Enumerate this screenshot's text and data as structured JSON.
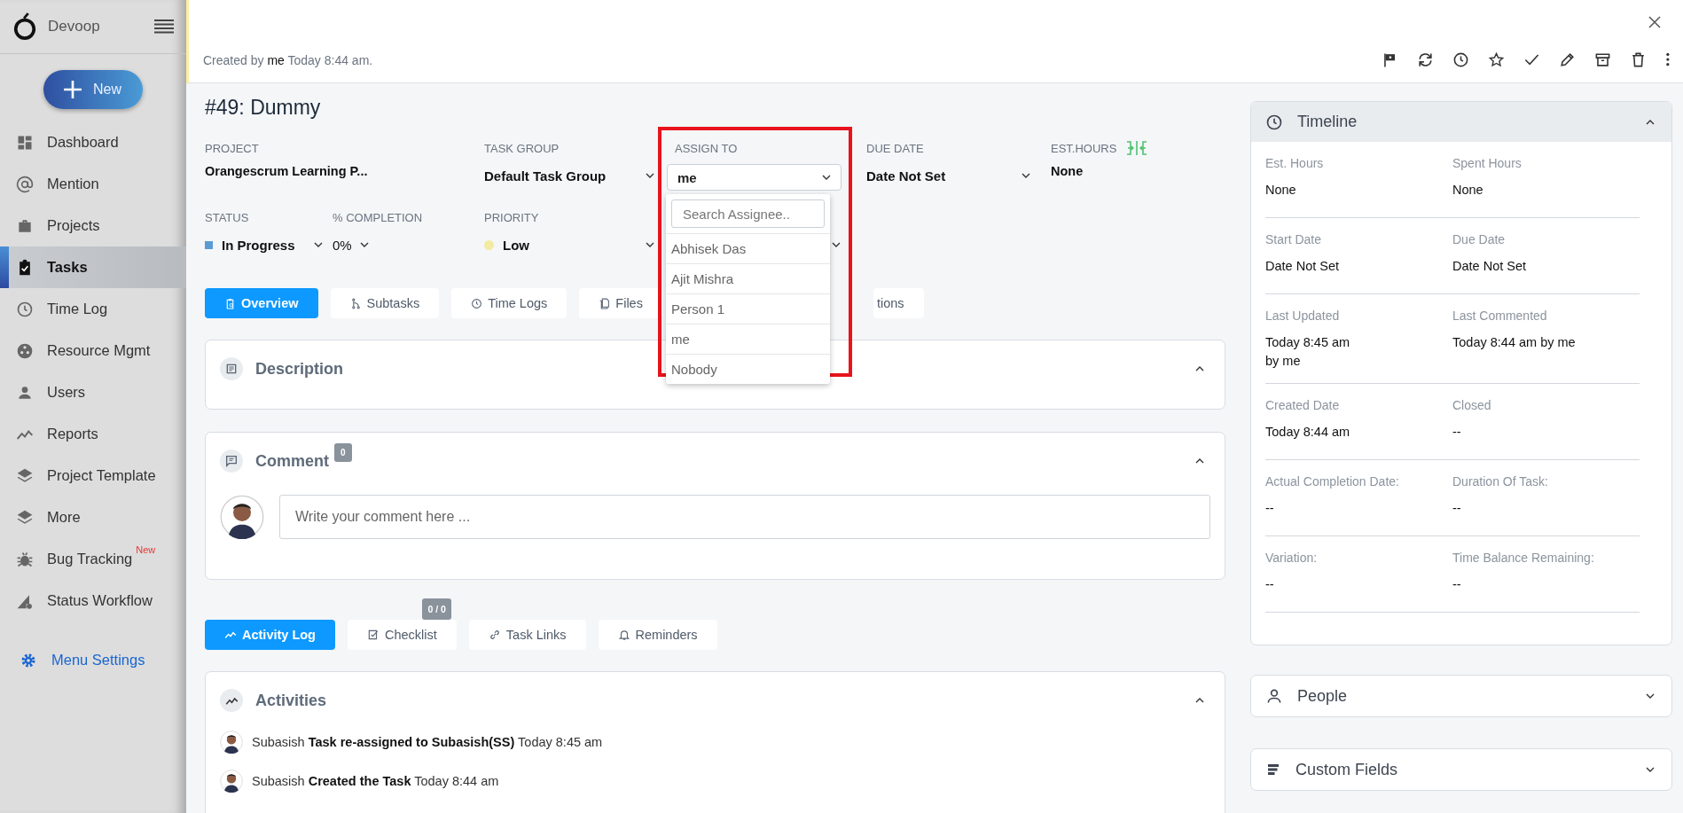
{
  "sidebar": {
    "brand": "Devoop",
    "new_button": "New",
    "items": [
      {
        "label": "Dashboard",
        "selected": false
      },
      {
        "label": "Mention",
        "selected": false
      },
      {
        "label": "Projects",
        "selected": false
      },
      {
        "label": "Tasks",
        "selected": true
      },
      {
        "label": "Time Log",
        "selected": false
      },
      {
        "label": "Resource Mgmt",
        "selected": false
      },
      {
        "label": "Users",
        "selected": false
      },
      {
        "label": "Reports",
        "selected": false
      },
      {
        "label": "Project Template",
        "selected": false
      },
      {
        "label": "More",
        "selected": false
      },
      {
        "label": "Bug Tracking",
        "badge": "New",
        "selected": false
      },
      {
        "label": "Status Workflow",
        "selected": false
      }
    ],
    "menu_settings": "Menu Settings"
  },
  "header": {
    "created_prefix": "Created by",
    "created_user": "me",
    "created_suffix": "Today 8:44 am."
  },
  "task": {
    "title": "#49: Dummy",
    "field_rows": [
      [
        {
          "label": "PROJECT",
          "value": "Orangescrum Learning P...",
          "kind": "text"
        },
        {
          "label": "TASK GROUP",
          "value": "Default Task Group",
          "kind": "select"
        },
        {
          "label": "ASSIGN TO",
          "value": "me",
          "kind": "open-select"
        },
        {
          "label": "DUE DATE",
          "value": "Date Not Set",
          "kind": "select"
        },
        {
          "label": "EST.HOURS",
          "value": "None",
          "kind": "hours"
        }
      ],
      [
        {
          "label": "STATUS",
          "value": "In Progress",
          "kind": "status",
          "color": "#5b9bd5"
        },
        {
          "label": "% COMPLETION",
          "value": "0%",
          "kind": "compact"
        },
        {
          "label": "PRIORITY",
          "value": "Low",
          "kind": "priority",
          "color": "#f3eba1"
        }
      ]
    ],
    "assignee_dropdown": {
      "placeholder": "Search Assignee..",
      "options": [
        "Abhisek Das",
        "Ajit Mishra",
        "Person 1",
        "me",
        "Nobody"
      ]
    }
  },
  "tabs": [
    {
      "label": "Overview",
      "selected": true
    },
    {
      "label": "Subtasks",
      "selected": false
    },
    {
      "label": "Time Logs",
      "selected": false
    },
    {
      "label": "Files",
      "selected": false
    },
    {
      "label": "tions",
      "selected": false
    }
  ],
  "description": {
    "title": "Description",
    "expanded": true
  },
  "comment": {
    "title": "Comment",
    "count": "0",
    "placeholder": "Write your comment here ...",
    "expanded": true
  },
  "activity_tabs": [
    {
      "label": "Activity Log",
      "selected": true
    },
    {
      "label": "Checklist",
      "badge": "0 / 0",
      "selected": false
    },
    {
      "label": "Task Links",
      "selected": false
    },
    {
      "label": "Reminders",
      "selected": false
    }
  ],
  "activities": {
    "title": "Activities",
    "expanded": true,
    "items": [
      "Subasish **Task re-assigned to Subasish(SS)** Today 8:45 am",
      "Subasish **Created the Task** Today 8:44 am"
    ]
  },
  "timeline": {
    "title": "Timeline",
    "expanded": true,
    "rows": [
      [
        {
          "label": "Est. Hours",
          "value": [
            "None"
          ]
        },
        {
          "label": "Spent Hours",
          "value": [
            "None"
          ]
        }
      ],
      [
        {
          "label": "Start Date",
          "value": [
            "Date Not Set"
          ]
        },
        {
          "label": "Due Date",
          "value": [
            "Date Not Set"
          ]
        }
      ],
      [
        {
          "label": "Last Updated",
          "value": [
            "Today 8:45 am",
            "by me"
          ]
        },
        {
          "label": "Last Commented",
          "value": [
            "Today 8:44 am by me"
          ]
        }
      ],
      [
        {
          "label": "Created Date",
          "value": [
            "Today 8:44 am"
          ]
        },
        {
          "label": "Closed",
          "value": [
            "--"
          ]
        }
      ],
      [
        {
          "label": "Actual Completion Date:",
          "value": [
            "--"
          ]
        },
        {
          "label": "Duration Of Task:",
          "value": [
            "--"
          ]
        }
      ],
      [
        {
          "label": "Variation:",
          "value": [
            "--"
          ]
        },
        {
          "label": "Time Balance Remaining:",
          "value": [
            "--"
          ]
        }
      ]
    ]
  },
  "people": {
    "title": "People",
    "expanded": false
  },
  "custom_fields": {
    "title": "Custom Fields",
    "expanded": false
  }
}
